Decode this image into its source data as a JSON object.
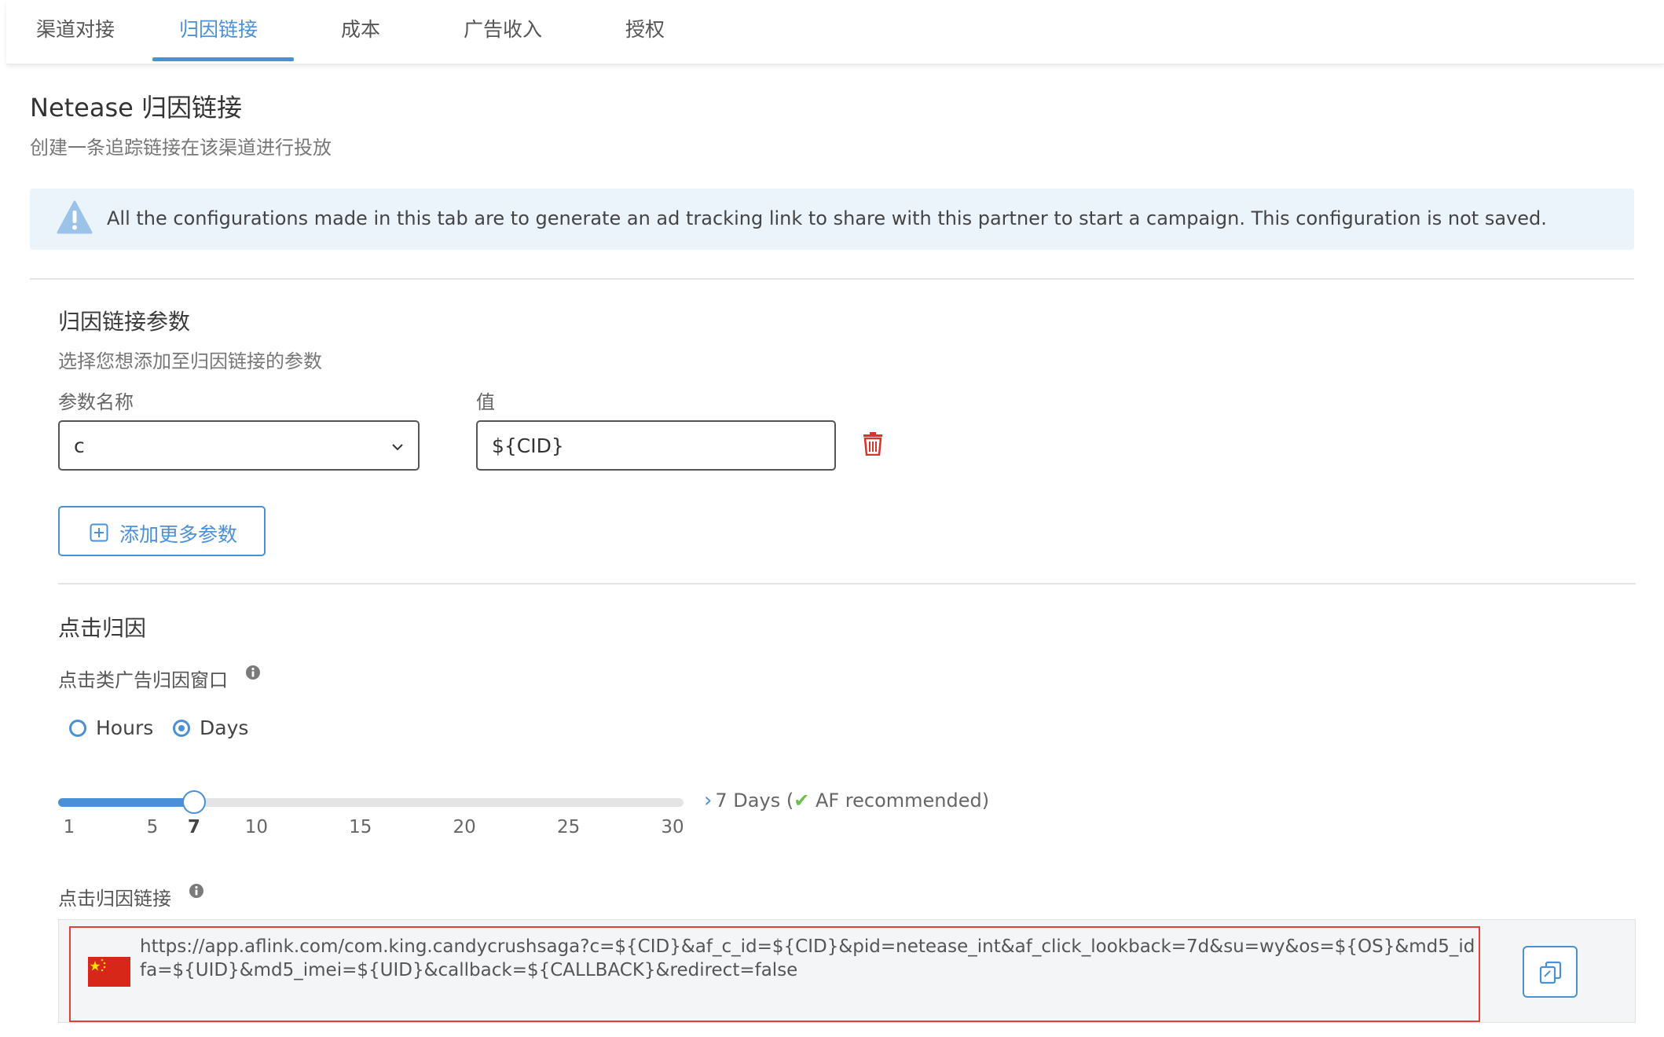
{
  "tabs": [
    {
      "label": "渠道对接"
    },
    {
      "label": "归因链接"
    },
    {
      "label": "成本"
    },
    {
      "label": "广告收入"
    },
    {
      "label": "授权"
    }
  ],
  "page": {
    "title": "Netease 归因链接",
    "subtitle": "创建一条追踪链接在该渠道进行投放"
  },
  "alert": {
    "text": "All the configurations made in this tab are to generate an ad tracking link to share with this partner to start a campaign. This configuration is not saved."
  },
  "params": {
    "title": "归因链接参数",
    "subtitle": "选择您想添加至归因链接的参数",
    "name_label": "参数名称",
    "value_label": "值",
    "selected_param": "c",
    "value": "${CID}",
    "add_button": "添加更多参数"
  },
  "click": {
    "title": "点击归因",
    "window_label": "点击类广告归因窗口",
    "radio_hours": "Hours",
    "radio_days": "Days",
    "selected_unit": "Days",
    "slider": {
      "min": 1,
      "max": 30,
      "value": 7,
      "ticks": [
        "1",
        "5",
        "7",
        "10",
        "15",
        "20",
        "25",
        "30"
      ]
    },
    "rec_prefix": "7 Days (",
    "rec_text": " AF recommended)",
    "link_label": "点击归因链接",
    "link_url": "https://app.aflink.com/com.king.candycrushsaga?c=${CID}&af_c_id=${CID}&pid=netease_int&af_click_lookback=7d&su=wy&os=${OS}&md5_idfa=${UID}&md5_imei=${UID}&callback=${CALLBACK}&redirect=false"
  },
  "colors": {
    "accent": "#4a90d9",
    "danger": "#e0403c",
    "success": "#6cc04a",
    "alert_bg": "#ebf3fb"
  }
}
